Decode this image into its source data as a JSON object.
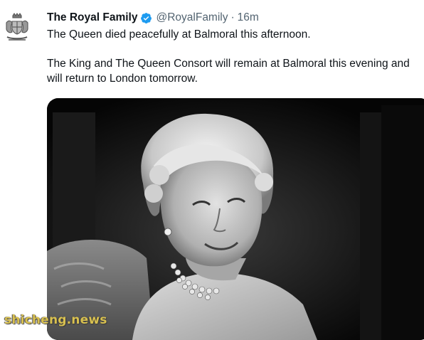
{
  "tweet": {
    "author_name": "The Royal Family",
    "handle": "@RoyalFamily",
    "separator": "·",
    "time": "16m",
    "verified": true,
    "text_line1": "The Queen died peacefully at Balmoral this afternoon.",
    "text_line2": "The King and The Queen Consort will remain at Balmoral this evening and will return to London tomorrow.",
    "media_description": "black-and-white portrait photograph"
  },
  "avatar_icon": "royal-coat-of-arms-icon",
  "verified_icon": "verified-badge-icon",
  "watermark": "shicheng.news",
  "colors": {
    "text": "#0f1419",
    "muted": "#536471",
    "verified": "#1d9bf0",
    "watermark": "#d8c050"
  }
}
